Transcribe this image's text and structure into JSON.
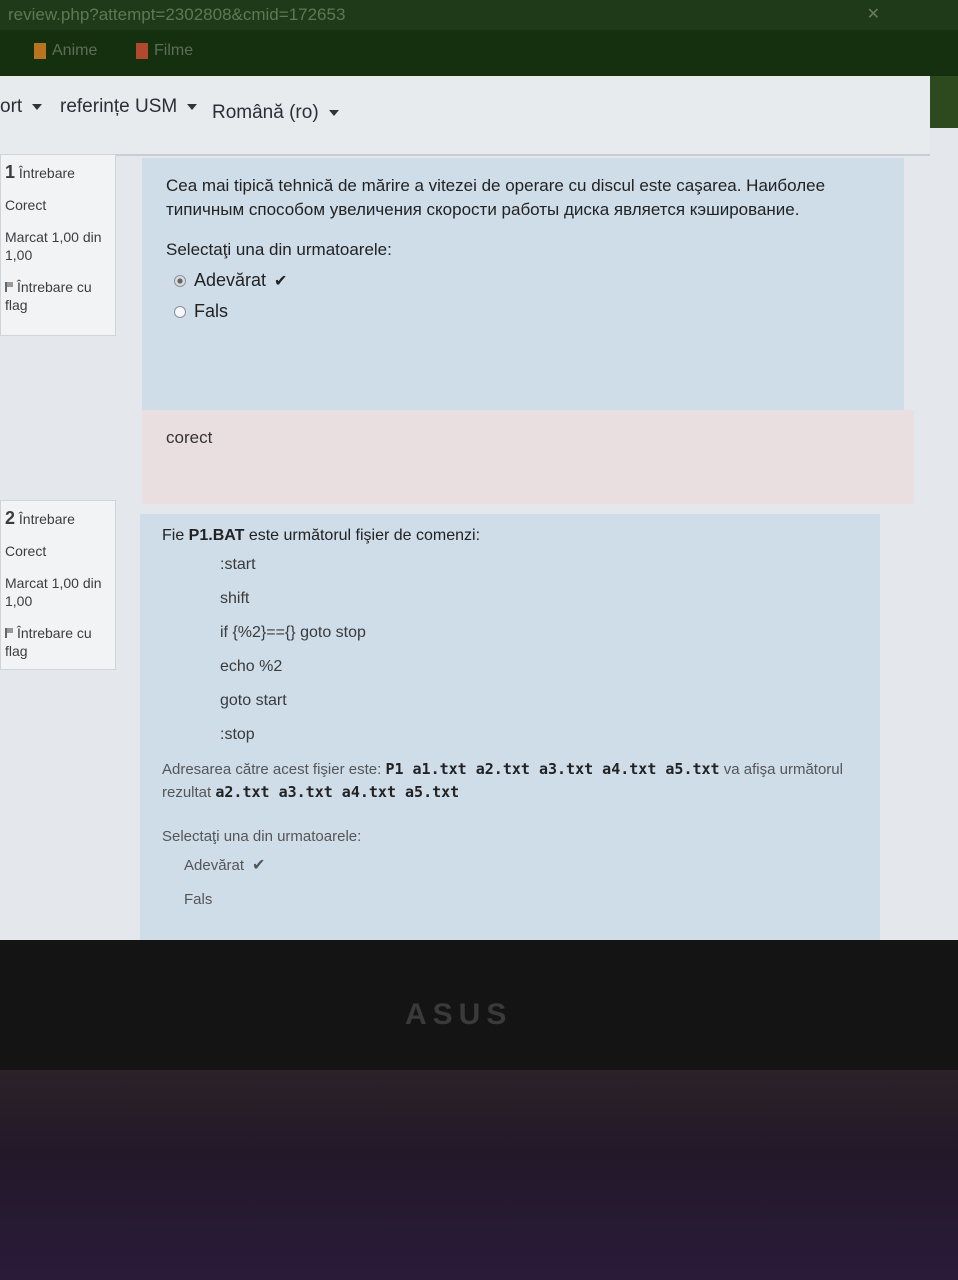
{
  "browser": {
    "url_fragment": "review.php?attempt=2302808&cmid=172653",
    "bookmarks": [
      {
        "label": "Anime",
        "icon": "folder-icon"
      },
      {
        "label": "Filme",
        "icon": "folder-icon"
      }
    ]
  },
  "nav": {
    "items": [
      {
        "label": "ort"
      },
      {
        "label": "referințe USM"
      },
      {
        "label": "Română (ro)"
      }
    ]
  },
  "questions": [
    {
      "number": "1",
      "label": "Întrebare",
      "status": "Corect",
      "mark": "Marcat 1,00 din 1,00",
      "flag": "Întrebare cu flag",
      "text": "Cea mai tipică tehnică de mărire a vitezei de operare cu discul este caşarea.  Наиболее типичным способом увеличения скорости работы диска является кэширование.",
      "prompt": "Selectaţi una din urmatoarele:",
      "options": [
        {
          "label": "Adevărat",
          "selected": true,
          "correct": true
        },
        {
          "label": "Fals",
          "selected": false,
          "correct": false
        }
      ],
      "feedback": "corect"
    },
    {
      "number": "2",
      "label": "Întrebare",
      "status": "Corect",
      "mark": "Marcat 1,00 din 1,00",
      "flag": "Întrebare cu flag",
      "intro_prefix": "Fie ",
      "intro_bold": "P1.BAT",
      "intro_suffix": " este următorul fişier de comenzi:",
      "code": [
        ":start",
        "shift",
        "if {%2}=={} goto stop",
        "echo %2",
        "goto start",
        ":stop"
      ],
      "addr_prefix": "Adresarea către acest fişier este: ",
      "addr_cmd": "P1 a1.txt  a2.txt  a3.txt  a4.txt  a5.txt",
      "addr_mid": "  va afişa următorul rezultat ",
      "addr_result": "a2.txt  a3.txt   a4.txt   a5.txt",
      "prompt": "Selectaţi una din urmatoarele:",
      "options": [
        {
          "label": "Adevărat",
          "selected": true,
          "correct": true
        },
        {
          "label": "Fals",
          "selected": false,
          "correct": false
        }
      ]
    }
  ],
  "laptop": {
    "brand": "ASUS"
  },
  "colors": {
    "question_bg": "#cfdde9",
    "feedback_bg": "#e9dfe0",
    "page_bg": "#e4e8ed"
  }
}
